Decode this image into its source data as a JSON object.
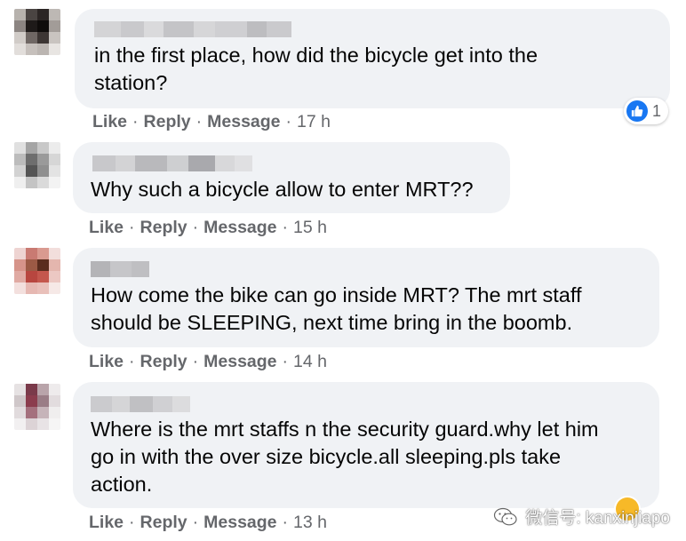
{
  "colors": {
    "bubble": "#f0f2f5",
    "text": "#050505",
    "secondary": "#65676b",
    "like_blue": "#1877f2"
  },
  "comments": [
    {
      "text_lines": [
        "in the first place, how did the bicycle get into the",
        "station?"
      ],
      "like": "Like",
      "reply": "Reply",
      "message": "Message",
      "time": "17 h",
      "reaction_count": "1",
      "reaction_icon": "like-thumb-icon"
    },
    {
      "text_lines": [
        "Why such a bicycle allow to enter MRT??"
      ],
      "like": "Like",
      "reply": "Reply",
      "message": "Message",
      "time": "15 h"
    },
    {
      "text_lines": [
        "How come the bike can go inside MRT? The mrt staff",
        "should be SLEEPING, next time bring in the boomb."
      ],
      "like": "Like",
      "reply": "Reply",
      "message": "Message",
      "time": "14 h"
    },
    {
      "text_lines": [
        "Where is the mrt staffs n the security guard.why let him",
        "go in with the over size bicycle.all sleeping.pls take",
        "action."
      ],
      "like": "Like",
      "reply": "Reply",
      "message": "Message",
      "time": "13 h"
    }
  ],
  "separator": "·",
  "watermark": {
    "icon": "wechat-icon",
    "text": "微信号: kanxinjiapo"
  }
}
